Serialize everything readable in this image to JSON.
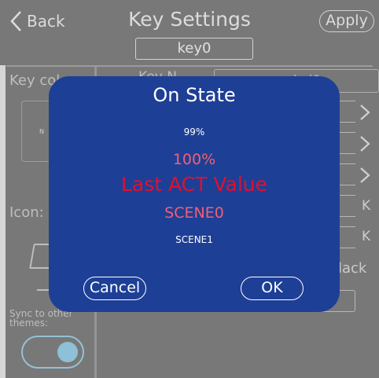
{
  "header": {
    "back_label": "Back",
    "title": "Key Settings",
    "apply_label": "Apply",
    "key_name": "key0"
  },
  "background": {
    "key_color_label": "Key col",
    "key_name_label": "Key N",
    "name_value": "bel0",
    "color_swatch_text": "N",
    "icon_label": "Icon:",
    "k_labels": [
      "K",
      "K"
    ],
    "back_word": "lack",
    "sync_label": "Sync to other themes:",
    "sync_enabled": true
  },
  "dialog": {
    "title": "On State",
    "options": [
      "99%",
      "100%",
      "Last ACT Value",
      "SCENE0",
      "SCENE1"
    ],
    "selected_option": "Last ACT Value",
    "cancel_label": "Cancel",
    "ok_label": "OK"
  },
  "colors": {
    "panel_background": "#787878",
    "dialog_background": "#1e3f96",
    "selected_option": "#e0102e",
    "adjacent_option": "#f06074",
    "toggle_accent": "#8ec0d7"
  },
  "icons": [
    "chevron-left-icon",
    "chevron-right-icon"
  ]
}
